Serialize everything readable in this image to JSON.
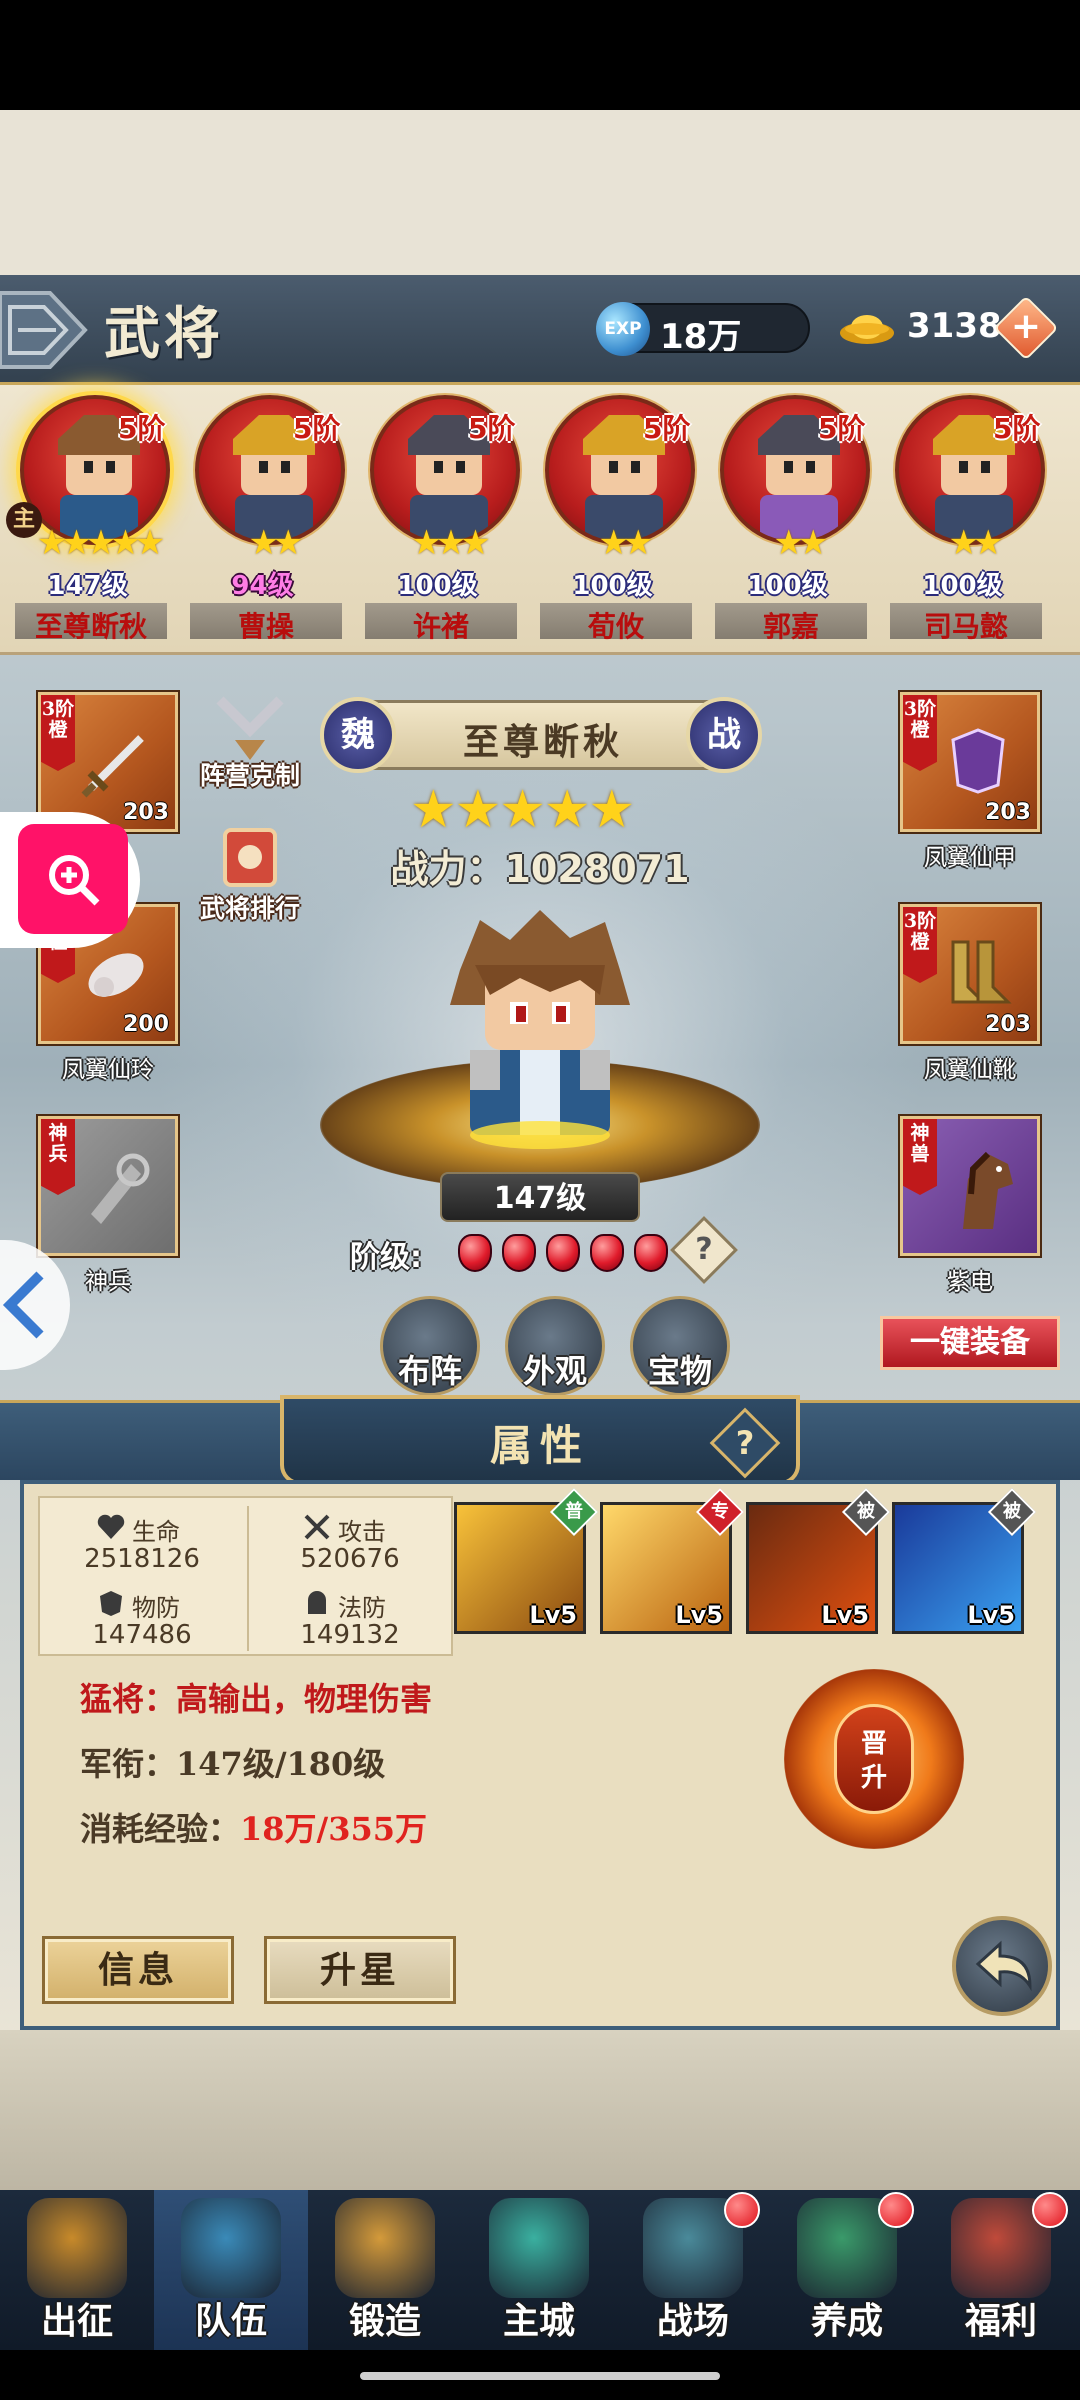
{
  "header": {
    "title": "武将",
    "exp_icon_text": "EXP",
    "exp_value": "18万",
    "gold_value": "3138",
    "gold_plus": "+"
  },
  "lord_badge": "主",
  "heroes": [
    {
      "name": "至尊断秋",
      "level": "147级",
      "rank": "5阶",
      "stars": "★★★★★",
      "selected": true
    },
    {
      "name": "曹操",
      "level": "94级",
      "rank": "5阶",
      "stars": "★★"
    },
    {
      "name": "许褚",
      "level": "100级",
      "rank": "5阶",
      "stars": "★★★"
    },
    {
      "name": "荀攸",
      "level": "100级",
      "rank": "5阶",
      "stars": "★★"
    },
    {
      "name": "郭嘉",
      "level": "100级",
      "rank": "5阶",
      "stars": "★★"
    },
    {
      "name": "司马懿",
      "level": "100级",
      "rank": "5阶",
      "stars": "★★"
    }
  ],
  "equipment": {
    "left": [
      {
        "tag": "3阶橙",
        "count": "203",
        "label": "剑"
      },
      {
        "tag": "阶橙",
        "count": "200",
        "label": "凤翼仙玲"
      },
      {
        "tag": "神兵",
        "count": "",
        "label": "神兵"
      }
    ],
    "right": [
      {
        "tag": "3阶橙",
        "count": "203",
        "label": "凤翼仙甲"
      },
      {
        "tag": "3阶橙",
        "count": "203",
        "label": "凤翼仙靴"
      },
      {
        "tag": "神兽",
        "count": "",
        "label": "紫电"
      }
    ]
  },
  "side_buttons": {
    "formation_counter": "阵营克制",
    "ranking": "武将排行"
  },
  "hero_detail": {
    "faction": "魏",
    "type_badge": "战",
    "name": "至尊断秋",
    "stars": "★★★★★",
    "power_label": "战力：",
    "power_value": "1028071",
    "level": "147级",
    "rank_label": "阶级:",
    "rank_gems": 5,
    "rank_help": "?"
  },
  "actions": {
    "formation": "布阵",
    "appearance": "外观",
    "treasure": "宝物",
    "equip_all": "一键装备"
  },
  "attributes": {
    "title": "属性",
    "help": "?",
    "stats": {
      "hp_label": "生命",
      "hp_value": "2518126",
      "atk_label": "攻击",
      "atk_value": "520676",
      "pdef_label": "物防",
      "pdef_value": "147486",
      "mdef_label": "法防",
      "mdef_value": "149132"
    },
    "skills": [
      {
        "level": "Lv5",
        "tag": "普",
        "tag_color": "#3a9a4a"
      },
      {
        "level": "Lv5",
        "tag": "专",
        "tag_color": "#d0202a"
      },
      {
        "level": "Lv5",
        "tag": "被",
        "tag_color": "#555555"
      },
      {
        "level": "Lv5",
        "tag": "被",
        "tag_color": "#555555"
      }
    ],
    "role_text": "猛将：高输出，物理伤害",
    "rank_text_label": "军衔：",
    "rank_text_value": "147级/180级",
    "exp_text_label": "消耗经验：",
    "exp_text_value": "18万/355万",
    "promote_label_1": "晋",
    "promote_label_2": "升",
    "tab_info": "信息",
    "tab_star": "升星"
  },
  "nav": [
    {
      "label": "出征",
      "dot": false,
      "active": false,
      "color": "#c88a2a"
    },
    {
      "label": "队伍",
      "dot": false,
      "active": true,
      "color": "#3a8ab8"
    },
    {
      "label": "锻造",
      "dot": false,
      "active": false,
      "color": "#d49a3a"
    },
    {
      "label": "主城",
      "dot": false,
      "active": false,
      "color": "#3ab0a0"
    },
    {
      "label": "战场",
      "dot": true,
      "active": false,
      "color": "#4a8a9a"
    },
    {
      "label": "养成",
      "dot": true,
      "active": false,
      "color": "#3a9a6a"
    },
    {
      "label": "福利",
      "dot": true,
      "active": false,
      "color": "#c04a3a"
    }
  ]
}
